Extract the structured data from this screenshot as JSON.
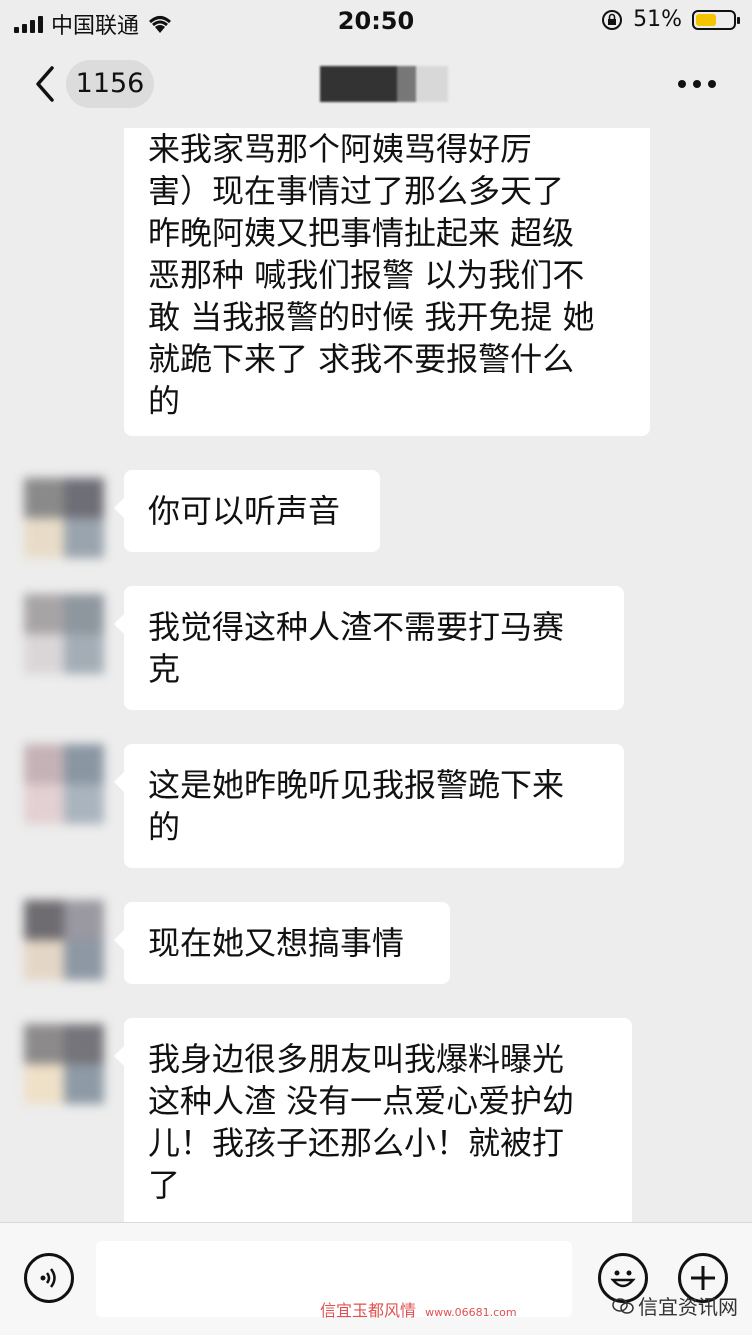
{
  "status_bar": {
    "carrier": "中国联通",
    "time": "20:50",
    "battery": "51%"
  },
  "nav": {
    "unread_count": "1156"
  },
  "messages": [
    {
      "text": "来我家骂那个阿姨骂得好厉\n害）现在事情过了那么多天了\n昨晚阿姨又把事情扯起来 超级\n恶那种 喊我们报警 以为我们不\n敢 当我报警的时候 我开免提 她\n就跪下来了 求我不要报警什么\n的"
    },
    {
      "text": "你可以听声音"
    },
    {
      "text": "我觉得这种人渣不需要打马赛\n克"
    },
    {
      "text": "这是她昨晚听见我报警跪下来\n的"
    },
    {
      "text": "现在她又想搞事情"
    },
    {
      "text": "我身边很多朋友叫我爆料曝光\n这种人渣 没有一点爱心爱护幼\n儿！我孩子还那么小！就被打\n了"
    }
  ],
  "watermarks": {
    "center": "信宜玉都风情",
    "center_url": "www.06681.com",
    "right": "信宜资讯网"
  },
  "icons": {
    "back": "chevron-left-icon",
    "more": "more-dots-icon",
    "voice": "voice-icon",
    "emoji": "emoji-icon",
    "add": "add-icon"
  }
}
